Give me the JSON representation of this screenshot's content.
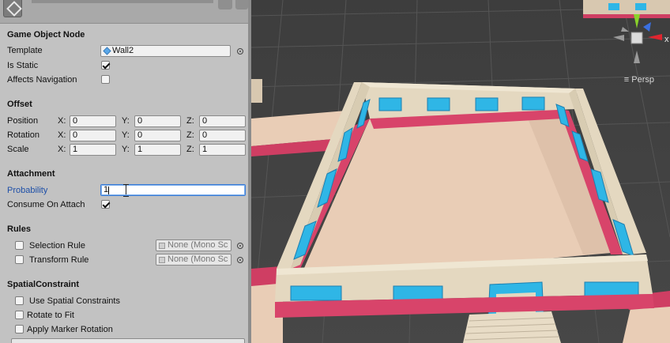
{
  "inspector": {
    "game_object_node": {
      "title": "Game Object Node",
      "template_label": "Template",
      "template_value": "Wall2",
      "is_static_label": "Is Static",
      "is_static": true,
      "affects_navigation_label": "Affects Navigation",
      "affects_navigation": false
    },
    "offset": {
      "title": "Offset",
      "rows": [
        {
          "label": "Position",
          "x": "0",
          "y": "0",
          "z": "0"
        },
        {
          "label": "Rotation",
          "x": "0",
          "y": "0",
          "z": "0"
        },
        {
          "label": "Scale",
          "x": "1",
          "y": "1",
          "z": "1"
        }
      ],
      "axis_x": "X:",
      "axis_y": "Y:",
      "axis_z": "Z:"
    },
    "attachment": {
      "title": "Attachment",
      "probability_label": "Probability",
      "probability_value": "1",
      "consume_label": "Consume On Attach",
      "consume": true
    },
    "rules": {
      "title": "Rules",
      "selection_rule_label": "Selection Rule",
      "selection_rule_value": "None (Mono Sc",
      "transform_rule_label": "Transform Rule",
      "transform_rule_value": "None (Mono Sc"
    },
    "spatial": {
      "title": "SpatialConstraint",
      "use_label": "Use Spatial Constraints",
      "rotate_label": "Rotate to Fit",
      "apply_label": "Apply Marker Rotation"
    }
  },
  "scene": {
    "projection_label": "Persp",
    "gizmo_x_label": "x",
    "colors": {
      "floor": "#e9cdb6",
      "wall": "#e4d8c0",
      "trim": "#d8446a",
      "window": "#2fb6e6",
      "gizmo_x": "#e0252f",
      "gizmo_y": "#8ad22a",
      "gizmo_z": "#3a6fe0"
    }
  }
}
